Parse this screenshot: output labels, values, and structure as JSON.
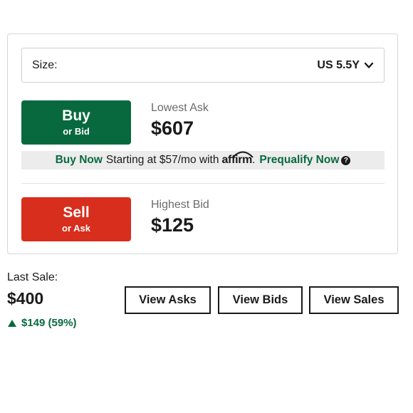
{
  "size_selector": {
    "label": "Size:",
    "value": "US 5.5Y"
  },
  "buy": {
    "button_main": "Buy",
    "button_sub": "or Bid",
    "price_label": "Lowest Ask",
    "price_value": "$607"
  },
  "financing": {
    "buy_now": "Buy Now",
    "starting_text": "Starting at $57/mo with",
    "affirm_logo": "affirm",
    "period": ".",
    "prequalify": "Prequalify Now",
    "help_symbol": "?"
  },
  "sell": {
    "button_main": "Sell",
    "button_sub": "or Ask",
    "price_label": "Highest Bid",
    "price_value": "$125"
  },
  "last_sale": {
    "label": "Last Sale:",
    "price": "$400",
    "change": "$149 (59%)",
    "change_direction": "up"
  },
  "buttons": {
    "view_asks": "View Asks",
    "view_bids": "View Bids",
    "view_sales": "View Sales"
  },
  "colors": {
    "buy_green": "#08693e",
    "sell_red": "#d72e1d",
    "affirm_bar_bg": "#ececec"
  },
  "icons": {
    "size_dropdown": "chevron-down-icon",
    "help": "help-icon",
    "change_indicator": "triangle-up-icon"
  }
}
